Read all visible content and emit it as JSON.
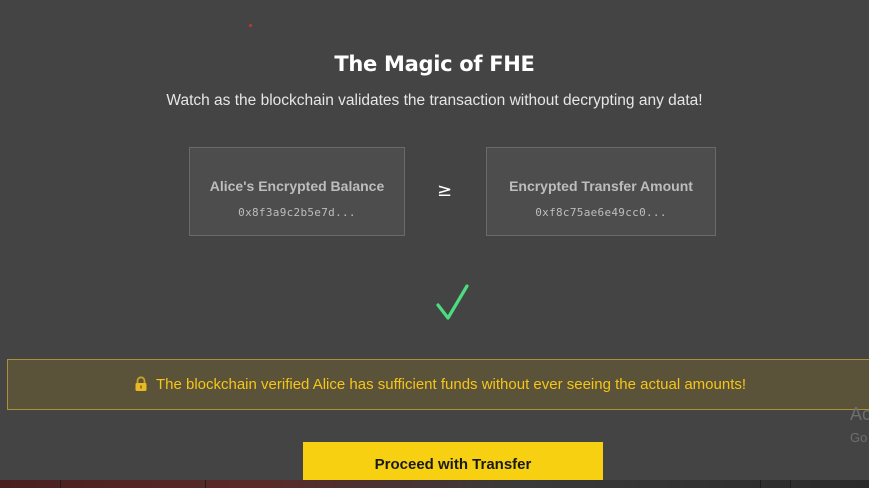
{
  "header": {
    "title": "The Magic of FHE",
    "subtitle": "Watch as the blockchain validates the transaction without decrypting any data!"
  },
  "comparison": {
    "left": {
      "label": "Alice's Encrypted Balance",
      "value": "0x8f3a9c2b5e7d..."
    },
    "operator": "≥",
    "right": {
      "label": "Encrypted Transfer Amount",
      "value": "0xf8c75ae6e49cc0..."
    }
  },
  "result": {
    "icon": "check-icon",
    "color": "#4ade80"
  },
  "banner": {
    "icon": "lock-icon",
    "text": "The blockchain verified Alice has sufficient funds without ever seeing the actual amounts!",
    "text_color": "#f5c518",
    "border_color": "#a89232"
  },
  "actions": {
    "proceed_label": "Proceed with Transfer",
    "button_color": "#f7d011"
  },
  "overlay": {
    "line1": "Ac",
    "line2": "Go"
  }
}
